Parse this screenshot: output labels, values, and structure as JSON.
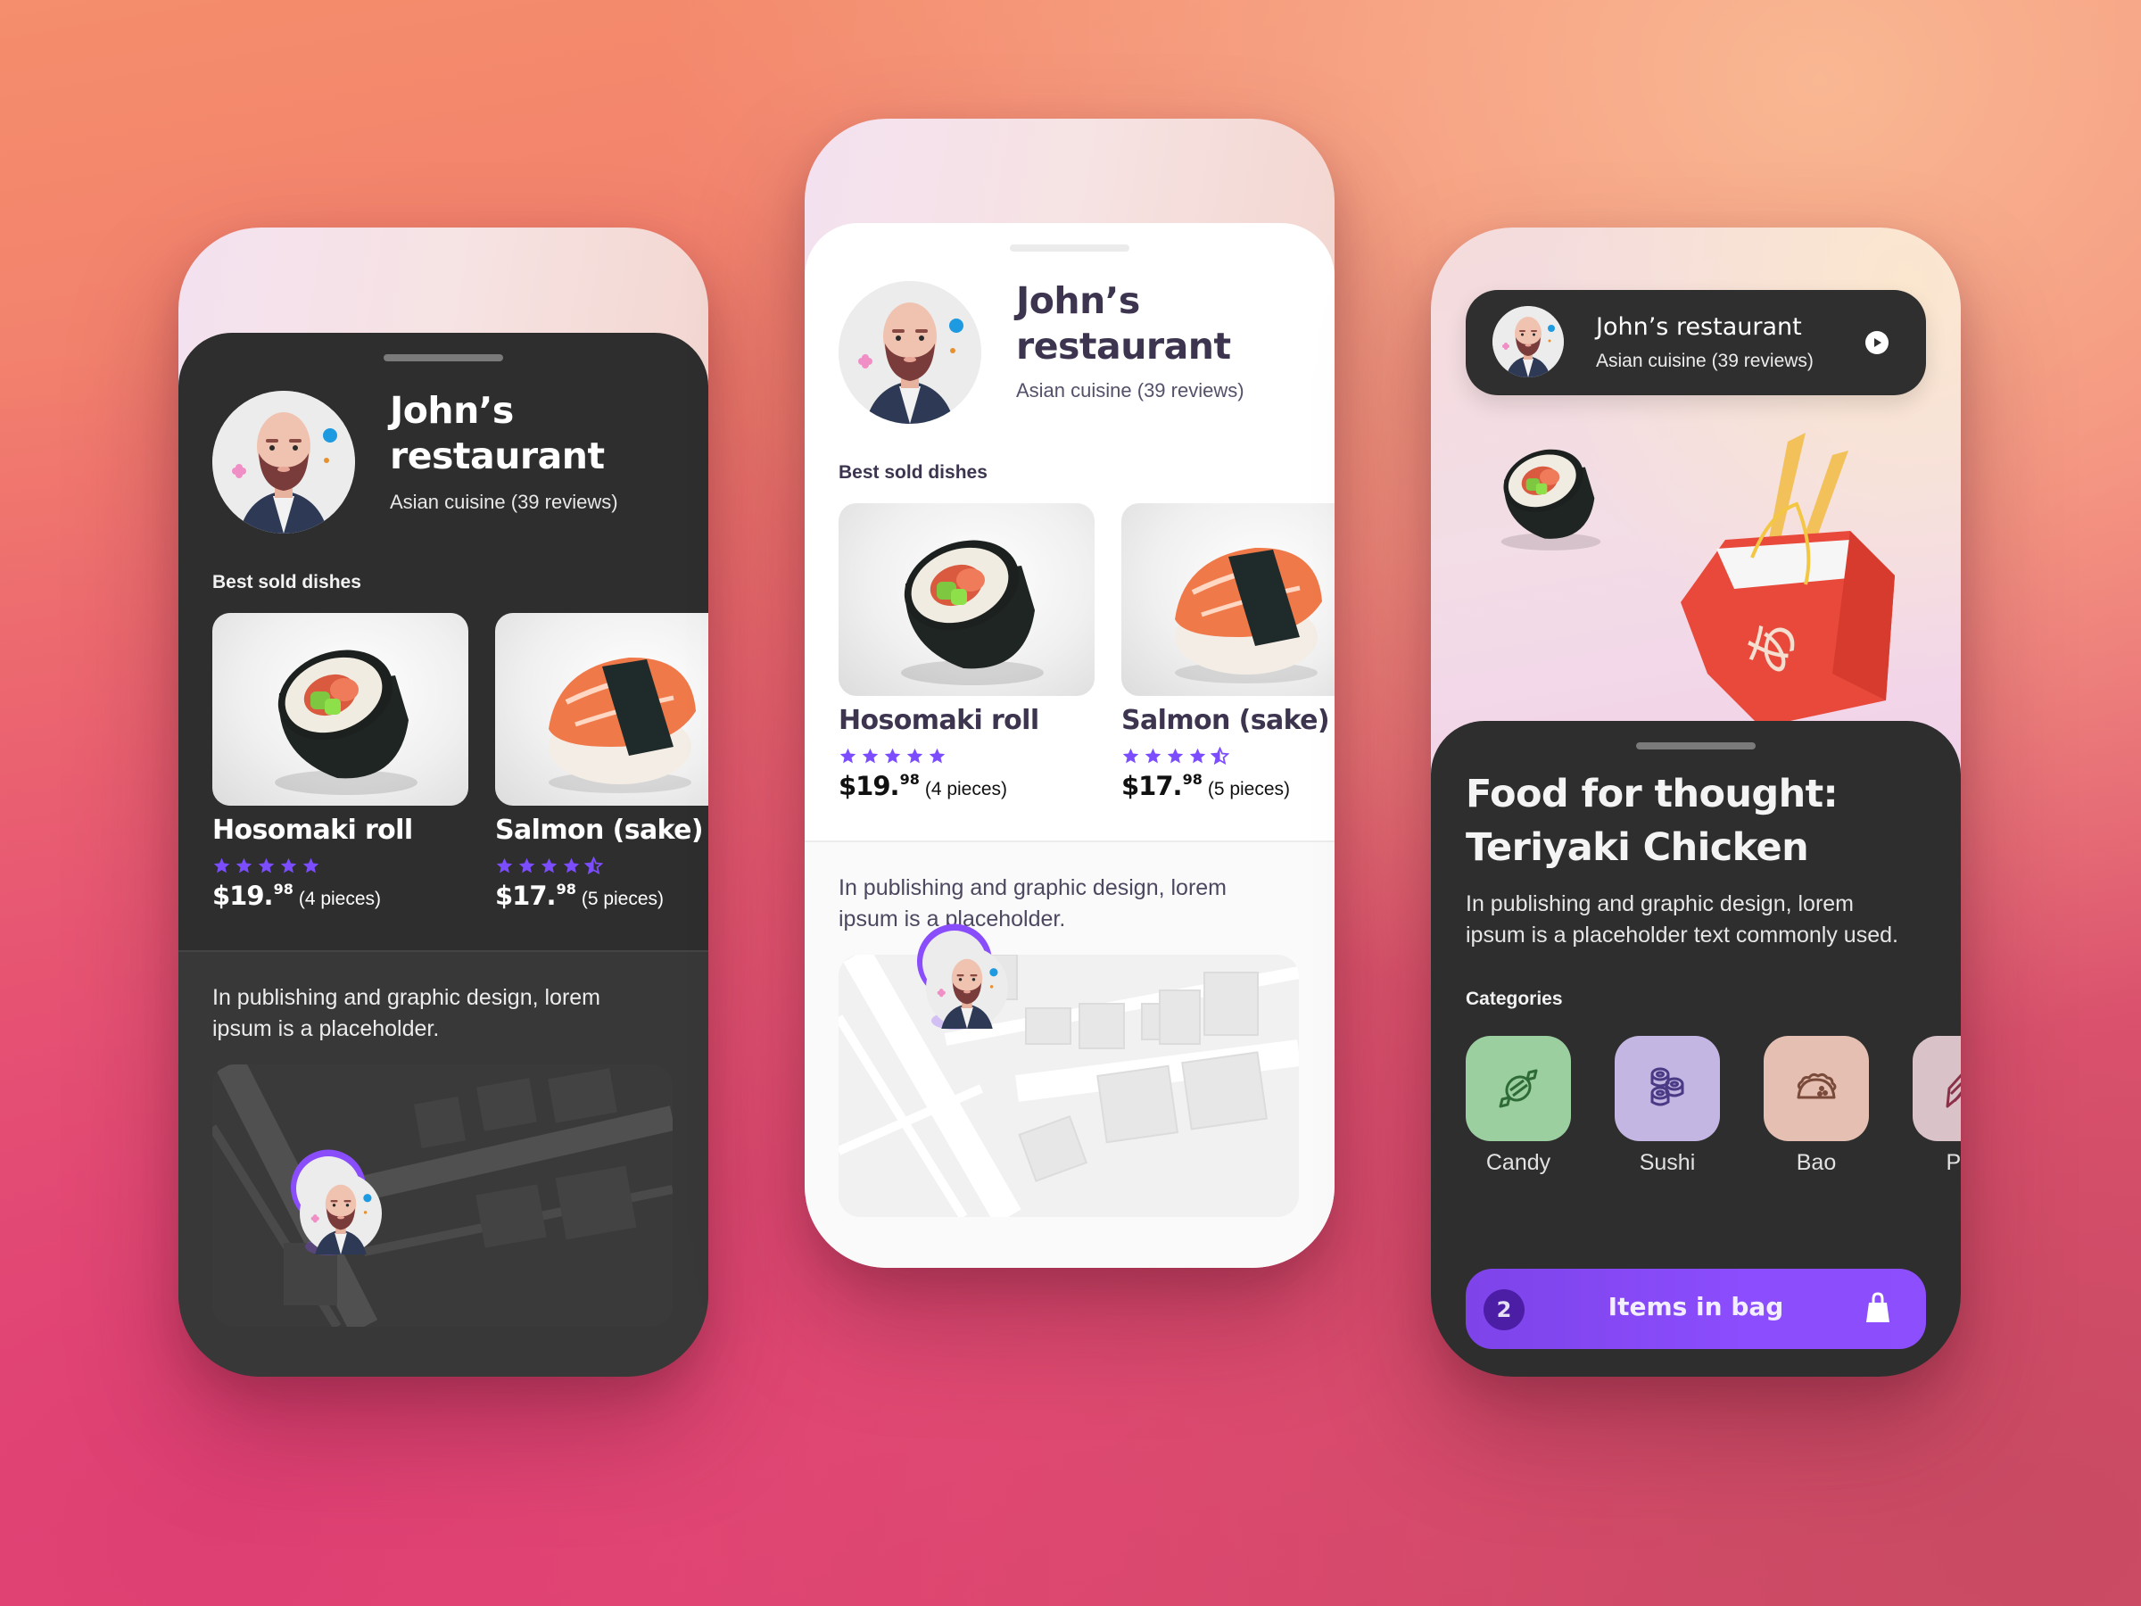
{
  "restaurant": {
    "name": "John’s restaurant",
    "name_line1": "John’s",
    "name_line2": "restaurant",
    "subtitle": "Asian cuisine (39 reviews)"
  },
  "best_sold": {
    "label": "Best sold dishes",
    "dishes": [
      {
        "name": "Hosomaki roll",
        "rating": 5,
        "price_main": "$19.",
        "price_cents": "98",
        "quantity": "(4 pieces)",
        "image": "hosomaki-roll"
      },
      {
        "name": "Salmon (sake)",
        "rating": 4.5,
        "price_main": "$17.",
        "price_cents": "98",
        "quantity": "(5 pieces)",
        "image": "salmon-nigiri"
      }
    ]
  },
  "description_short_line1": "In publishing and graphic design, lorem",
  "description_short_line2": "ipsum is a placeholder.",
  "article": {
    "title_line1": "Food for thought:",
    "title_line2": "Teriyaki Chicken",
    "body_line1": "In publishing and graphic design, lorem",
    "body_line2": "ipsum is a placeholder text commonly used."
  },
  "categories": {
    "label": "Categories",
    "items": [
      {
        "label": "Candy",
        "icon": "candy-icon",
        "color": "#9ccf9f",
        "icon_color": "#2e6b36"
      },
      {
        "label": "Sushi",
        "icon": "sushi-icon",
        "color": "#c4b6e2",
        "icon_color": "#4a3a85"
      },
      {
        "label": "Bao",
        "icon": "taco-icon",
        "color": "#e5c0b2",
        "icon_color": "#7a4a3a"
      },
      {
        "label": "Pas",
        "icon": "croissant-icon",
        "color": "#d9c3c8",
        "icon_color": "#8a3048"
      }
    ]
  },
  "bag": {
    "count": "2",
    "label": "Items in bag"
  },
  "colors": {
    "accent": "#8b4dfd",
    "star": "#7c4dff",
    "dark_surface": "#2e2e2e",
    "light_surface": "#ffffff"
  }
}
